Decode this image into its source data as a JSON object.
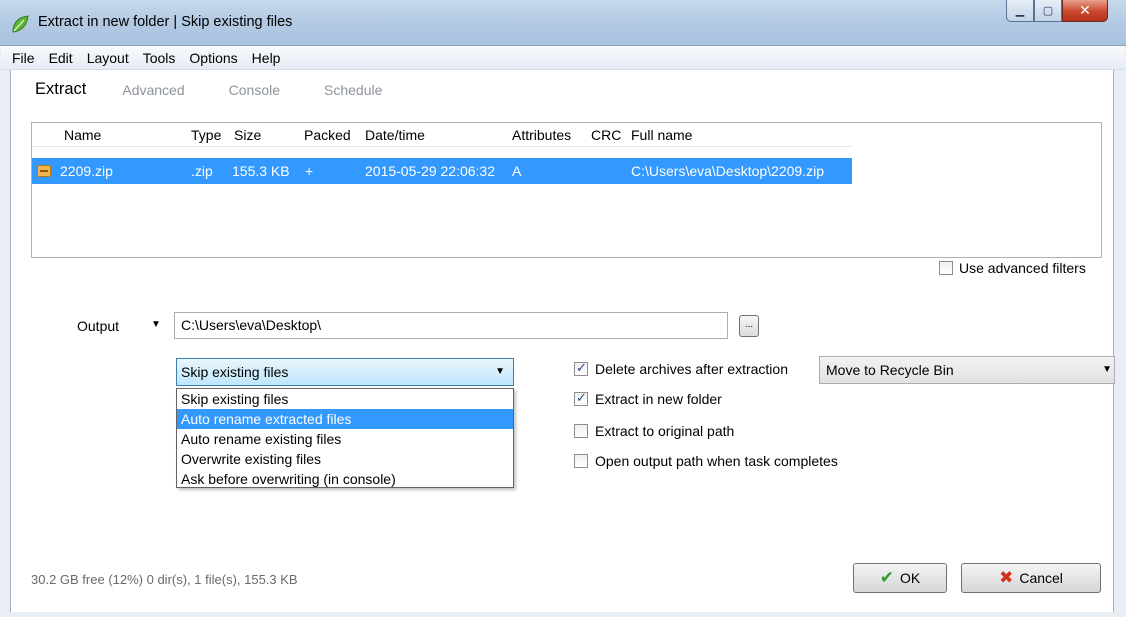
{
  "window": {
    "title": "Extract in new folder | Skip existing files",
    "controls": [
      "minimize-icon",
      "maximize-icon",
      "close-icon"
    ]
  },
  "menu": [
    "File",
    "Edit",
    "Layout",
    "Tools",
    "Options",
    "Help"
  ],
  "tabs": [
    "Extract",
    "Advanced",
    "Console",
    "Schedule"
  ],
  "file_list": {
    "columns": [
      "Name",
      "Type",
      "Size",
      "Packed",
      "Date/time",
      "Attributes",
      "CRC",
      "Full name"
    ],
    "rows": [
      {
        "name": "2209.zip",
        "type": ".zip",
        "size": "155.3 KB",
        "packed": "+",
        "datetime": "2015-05-29 22:06:32",
        "attributes": "A",
        "crc": "",
        "fullname": "C:\\Users\\eva\\Desktop\\2209.zip"
      }
    ]
  },
  "advanced_filters": {
    "label": "Use advanced filters",
    "checked": false
  },
  "output": {
    "label": "Output",
    "path": "C:\\Users\\eva\\Desktop\\",
    "browse_label": "..."
  },
  "overwrite": {
    "selected": "Skip existing files",
    "options": [
      "Skip existing files",
      "Auto rename extracted files",
      "Auto rename existing files",
      "Overwrite existing files",
      "Ask before overwriting (in console)"
    ],
    "highlighted_index": 1
  },
  "options": [
    {
      "label": "Delete archives after extraction",
      "checked": true
    },
    {
      "label": "Extract in new folder",
      "checked": true
    },
    {
      "label": "Extract to original path",
      "checked": false
    },
    {
      "label": "Open output path when task completes",
      "checked": false
    }
  ],
  "delete_mode": {
    "selected": "Move to Recycle Bin"
  },
  "status": "30.2 GB free (12%)   0 dir(s), 1 file(s), 155.3 KB",
  "buttons": {
    "ok": "OK",
    "cancel": "Cancel"
  }
}
